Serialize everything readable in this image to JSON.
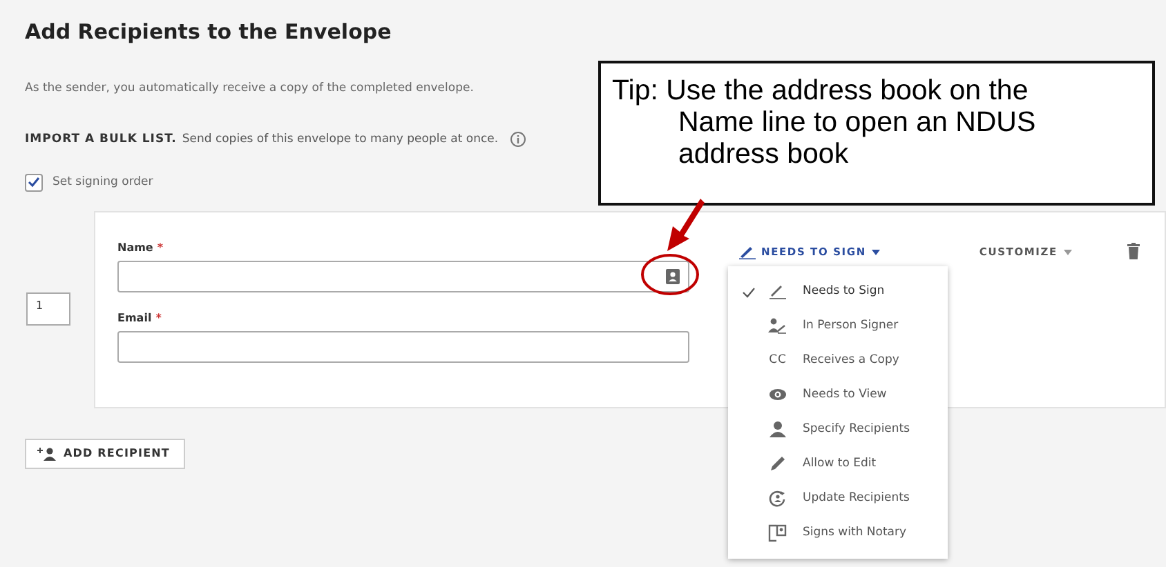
{
  "title": "Add Recipients to the Envelope",
  "sender_note": "As the sender, you automatically receive a copy of the completed envelope.",
  "bulk_import": {
    "label": "IMPORT A BULK LIST.",
    "text": "Send copies of this envelope to many people at once."
  },
  "signing_order": {
    "label": "Set signing order",
    "checked": true
  },
  "recipients": [
    {
      "order": "1",
      "name_label": "Name",
      "email_label": "Email",
      "required_mark": "*",
      "role": "NEEDS TO SIGN",
      "customize": "CUSTOMIZE"
    }
  ],
  "role_menu": [
    {
      "kind": "sign",
      "label": "Needs to Sign",
      "selected": true
    },
    {
      "kind": "in-person",
      "label": "In Person Signer",
      "selected": false
    },
    {
      "kind": "cc",
      "icon_text": "CC",
      "label": "Receives a Copy",
      "selected": false
    },
    {
      "kind": "view",
      "label": "Needs to View",
      "selected": false
    },
    {
      "kind": "specify",
      "label": "Specify Recipients",
      "selected": false
    },
    {
      "kind": "edit",
      "label": "Allow to Edit",
      "selected": false
    },
    {
      "kind": "update",
      "label": "Update Recipients",
      "selected": false
    },
    {
      "kind": "notary",
      "label": "Signs with Notary",
      "selected": false
    }
  ],
  "add_recipient_button": "ADD RECIPIENT",
  "tip": {
    "label": "Tip:",
    "text": "Use the address book on the Name line to open an NDUS address book"
  }
}
